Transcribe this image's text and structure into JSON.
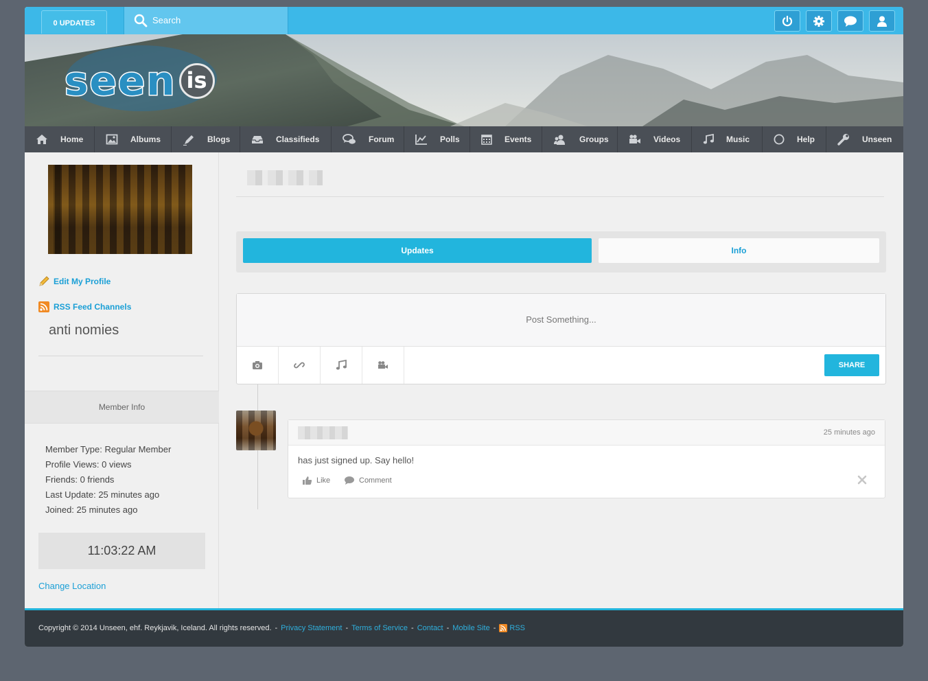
{
  "topbar": {
    "updates_label": "0 UPDATES",
    "search_placeholder": "Search",
    "icons": [
      "power-icon",
      "gear-icon",
      "chat-icon",
      "user-icon"
    ]
  },
  "banner": {
    "logo_text": "seen",
    "logo_suffix": "is"
  },
  "nav": {
    "items": [
      {
        "label": "Home",
        "icon": "home-icon"
      },
      {
        "label": "Albums",
        "icon": "image-icon"
      },
      {
        "label": "Blogs",
        "icon": "pen-icon"
      },
      {
        "label": "Classifieds",
        "icon": "inbox-icon"
      },
      {
        "label": "Forum",
        "icon": "comments-icon"
      },
      {
        "label": "Polls",
        "icon": "chart-icon"
      },
      {
        "label": "Events",
        "icon": "calendar-icon"
      },
      {
        "label": "Groups",
        "icon": "group-icon"
      },
      {
        "label": "Videos",
        "icon": "video-icon"
      },
      {
        "label": "Music",
        "icon": "music-icon"
      },
      {
        "label": "Help",
        "icon": "circle-icon"
      },
      {
        "label": "Unseen",
        "icon": "wrench-icon"
      }
    ]
  },
  "sidebar": {
    "edit_profile": "Edit My Profile",
    "rss_feed": "RSS Feed Channels",
    "name": "anti nomies",
    "member_info_title": "Member Info",
    "info": [
      "Member Type: Regular Member",
      "Profile Views: 0 views",
      "Friends: 0 friends",
      "Last Update: 25 minutes ago",
      "Joined: 25 minutes ago"
    ],
    "clock": "11:03:22 AM",
    "change_location": "Change Location"
  },
  "main": {
    "tabs": [
      {
        "label": "Updates",
        "active": true
      },
      {
        "label": "Info",
        "active": false
      }
    ],
    "composer": {
      "prompt": "Post Something...",
      "tools": [
        "camera-icon",
        "link-icon",
        "music-icon",
        "video-icon"
      ],
      "share_label": "SHARE"
    },
    "post": {
      "time": "25 minutes ago",
      "text": "has just signed up. Say hello!",
      "like_label": "Like",
      "comment_label": "Comment"
    }
  },
  "footer": {
    "copyright": "Copyright © 2014 Unseen, ehf. Reykjavik, Iceland. All rights reserved.",
    "links": [
      "Privacy Statement",
      "Terms of Service",
      "Contact",
      "Mobile Site"
    ],
    "rss_label": "RSS"
  },
  "colors": {
    "accent": "#22b5dd",
    "topbar": "#3cb8e8",
    "nav": "#4a4f56",
    "footer": "#32393f",
    "page_bg": "#5d6570"
  }
}
